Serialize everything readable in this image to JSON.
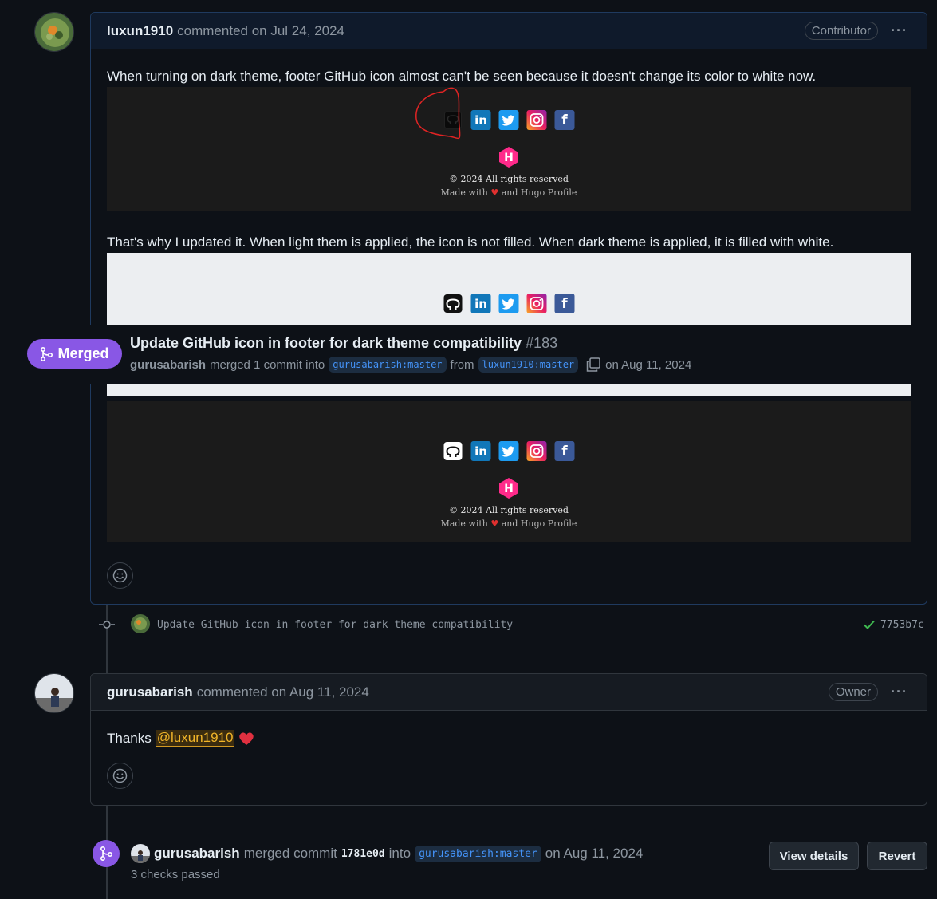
{
  "comment1": {
    "author": "luxun1910",
    "meta": "commented on Jul 24, 2024",
    "role": "Contributor",
    "menu": "···",
    "text1": "When turning on dark theme, footer GitHub icon almost can't be seen because it doesn't change its color to white now.",
    "text2": "That's why I updated it. When light them is applied, the icon is not filled. When dark theme is applied, it is filled with white.",
    "footer_copyright": "© 2024 All rights reserved",
    "footer_made_prefix": "Made with",
    "footer_made_suffix": "and Hugo Profile"
  },
  "icons": {
    "github": "github-icon",
    "linkedin": "in",
    "twitter": "twitter-icon",
    "instagram": "instagram-icon",
    "facebook": "f",
    "hugo": "H"
  },
  "merged_header": {
    "badge": "Merged",
    "title": "Update GitHub icon in footer for dark theme compatibility",
    "number": "#183",
    "user": "gurusabarish",
    "action": "merged 1 commit into",
    "base_branch": "gurusabarish:master",
    "from": "from",
    "head_branch": "luxun1910:master",
    "date": "on Aug 11, 2024"
  },
  "commit": {
    "message": "Update GitHub icon in footer for dark theme compatibility",
    "sha": "7753b7c"
  },
  "comment2": {
    "author": "gurusabarish",
    "meta": "commented on Aug 11, 2024",
    "role": "Owner",
    "menu": "···",
    "text": "Thanks",
    "mention": "@luxun1910"
  },
  "merge_event": {
    "user": "gurusabarish",
    "action": "merged commit",
    "sha": "1781e0d",
    "into": "into",
    "branch": "gurusabarish:master",
    "date": "on Aug 11, 2024",
    "checks": "3 checks passed",
    "view_details": "View details",
    "revert": "Revert"
  },
  "colors": {
    "background": "#0d1117",
    "merged_purple": "#8957e5",
    "link_blue": "#4493f8",
    "check_green": "#3fb950"
  }
}
